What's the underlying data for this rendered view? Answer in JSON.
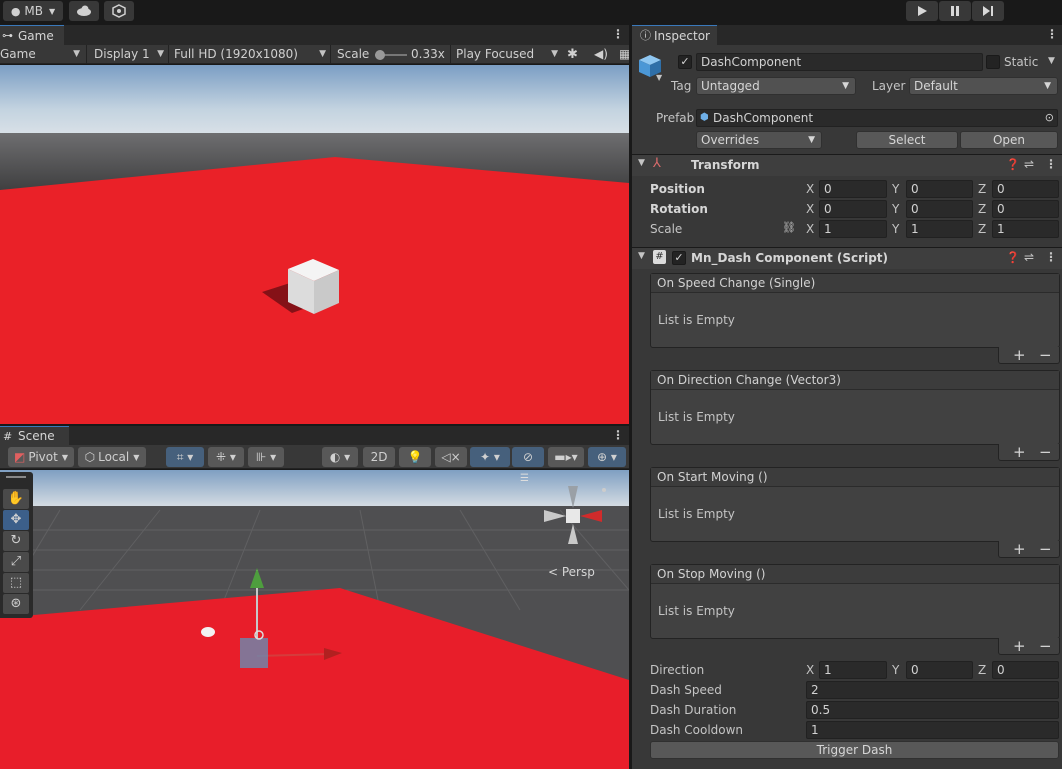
{
  "toolbar": {
    "account": "MB",
    "play_icon": "play-icon",
    "pause_icon": "pause-icon",
    "step_icon": "step-icon"
  },
  "game": {
    "tab": "Game",
    "view_dropdown": "Game",
    "display": "Display 1",
    "resolution": "Full HD (1920x1080)",
    "scale_label": "Scale",
    "scale_value": "0.33x",
    "play_mode": "Play Focused"
  },
  "scene": {
    "tab": "Scene",
    "pivot": "Pivot",
    "local": "Local",
    "mode_2d": "2D",
    "persp_label": "< Persp"
  },
  "inspector": {
    "tab": "Inspector",
    "object_name": "DashComponent",
    "static_label": "Static",
    "tag_label": "Tag",
    "tag_value": "Untagged",
    "layer_label": "Layer",
    "layer_value": "Default",
    "prefab_label": "Prefab",
    "prefab_value": "DashComponent",
    "overrides": "Overrides",
    "select_button": "Select",
    "open_button": "Open",
    "transform": {
      "title": "Transform",
      "position_label": "Position",
      "rotation_label": "Rotation",
      "scale_label": "Scale",
      "position": {
        "x": "0",
        "y": "0",
        "z": "0"
      },
      "rotation": {
        "x": "0",
        "y": "0",
        "z": "0"
      },
      "scale": {
        "x": "1",
        "y": "1",
        "z": "1"
      },
      "axis_x": "X",
      "axis_y": "Y",
      "axis_z": "Z"
    },
    "script": {
      "title": "Mn_Dash Component (Script)",
      "events": [
        {
          "title": "On Speed Change (Single)",
          "empty": "List is Empty"
        },
        {
          "title": "On Direction Change (Vector3)",
          "empty": "List is Empty"
        },
        {
          "title": "On Start Moving ()",
          "empty": "List is Empty"
        },
        {
          "title": "On Stop Moving ()",
          "empty": "List is Empty"
        }
      ],
      "plus": "+",
      "minus": "−",
      "direction_label": "Direction",
      "direction": {
        "x": "1",
        "y": "0",
        "z": "0"
      },
      "dash_speed_label": "Dash Speed",
      "dash_speed": "2",
      "dash_duration_label": "Dash Duration",
      "dash_duration": "0.5",
      "dash_cooldown_label": "Dash Cooldown",
      "dash_cooldown": "1",
      "trigger_button": "Trigger Dash"
    }
  },
  "colors": {
    "panel_bg": "#383838",
    "field_bg": "#2a2a2a",
    "accent_blue": "#3a79bb",
    "ground_red": "#e8232e"
  }
}
